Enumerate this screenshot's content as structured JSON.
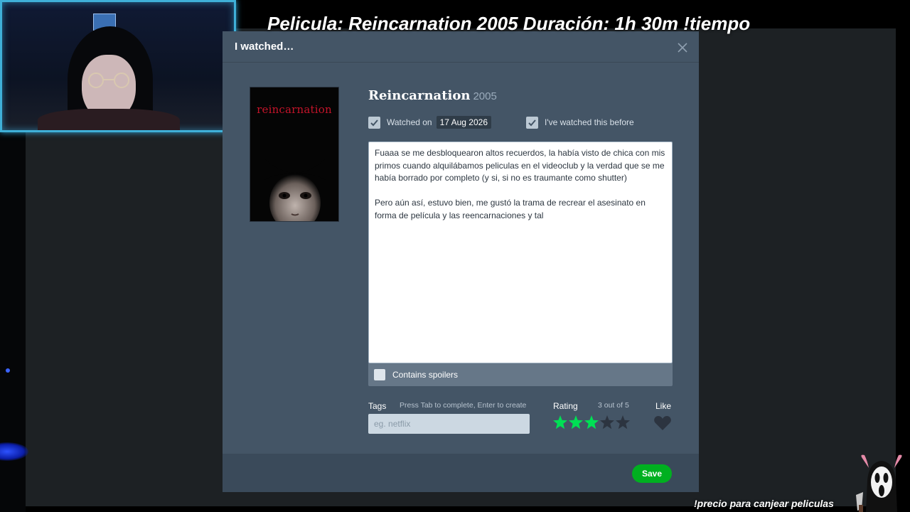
{
  "stream": {
    "title": "Pelicula: Reincarnation 2005 Duración: 1h 30m  !tiempo",
    "footer": "!precio para canjear peliculas"
  },
  "modal": {
    "title": "I watched…",
    "close_icon": "close-icon"
  },
  "film": {
    "title": "Reincarnation",
    "year": "2005",
    "poster_text": "reincarnation"
  },
  "watched": {
    "label": "Watched on",
    "date": "17 Aug 2026",
    "checked": true
  },
  "rewatch": {
    "label": "I've watched this before",
    "checked": true
  },
  "review": {
    "paragraphs": [
      "Fuaaa se me desbloquearon altos recuerdos, la había visto de chica con mis primos cuando alquilábamos peliculas en el videoclub y la verdad que se me había borrado por completo (y si, si no es traumante como shutter)",
      "Pero aún así, estuvo bien, me gustó la trama de recrear el asesinato en forma de película y las reencarnaciones y tal"
    ]
  },
  "spoilers": {
    "label": "Contains spoilers",
    "checked": false
  },
  "tags": {
    "label": "Tags",
    "hint": "Press Tab to complete, Enter to create",
    "placeholder": "eg. netflix"
  },
  "rating": {
    "label": "Rating",
    "value_text": "3 out of 5",
    "value": 3,
    "max": 5,
    "active_color": "#00e054",
    "inactive_color": "#2c3440"
  },
  "like": {
    "label": "Like",
    "liked": false
  },
  "save_label": "Save",
  "colors": {
    "modal_bg": "#445566",
    "save_green": "#00b020",
    "webcam_border": "#3fb0d8"
  }
}
